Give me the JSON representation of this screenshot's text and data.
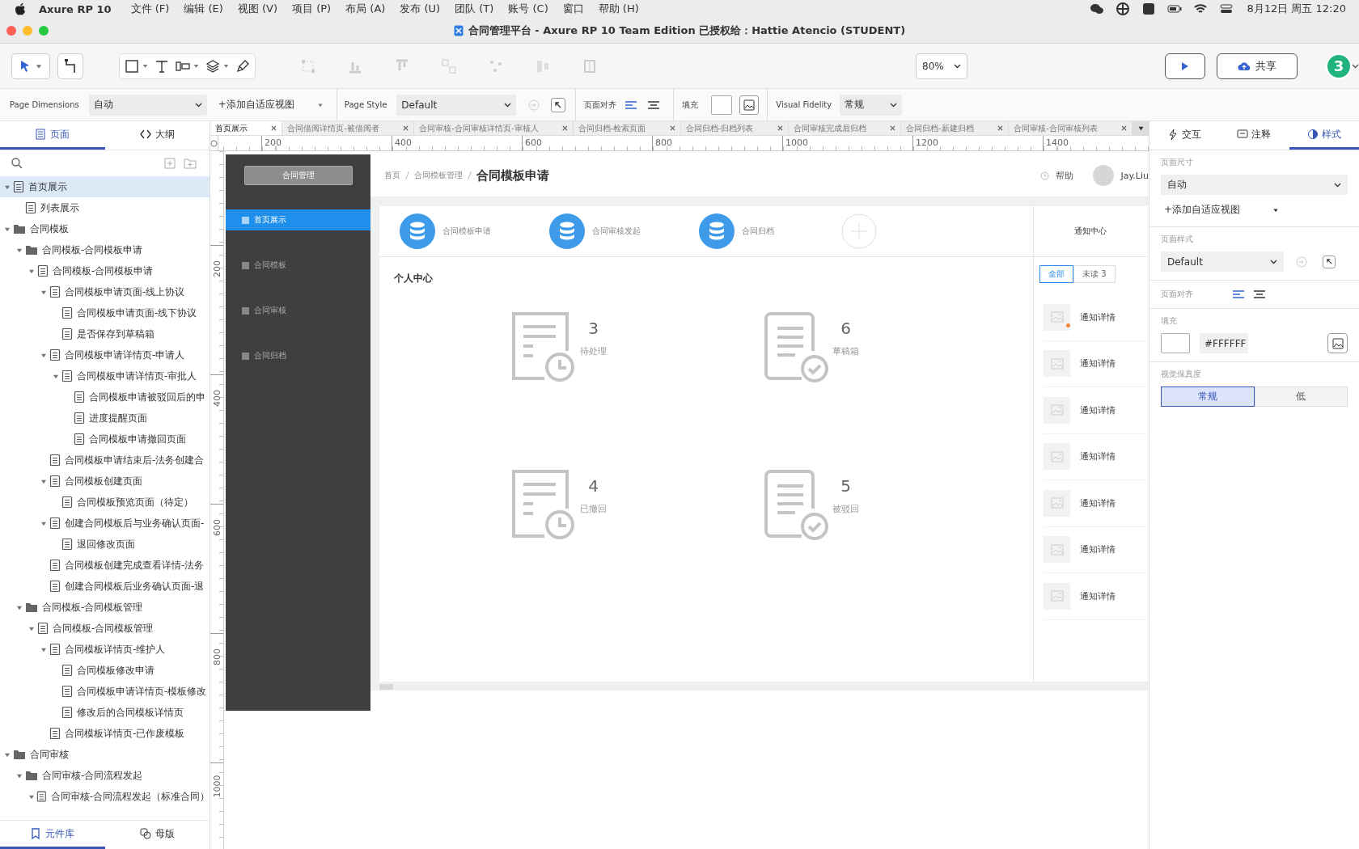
{
  "menu_bar": {
    "app": "Axure RP 10",
    "menus": [
      "文件 (F)",
      "编辑 (E)",
      "视图 (V)",
      "项目 (P)",
      "布局 (A)",
      "发布 (U)",
      "团队 (T)",
      "账号 (C)",
      "窗口",
      "帮助 (H)"
    ],
    "clock": "8月12日 周五  12:20"
  },
  "window": {
    "title": "合同管理平台 - Axure RP 10 Team Edition  已授权给：Hattie Atencio (STUDENT)"
  },
  "toolbar": {
    "zoom": "80%",
    "share": "共享",
    "user_badge": "3"
  },
  "style_bar": {
    "page_dimensions_label": "Page Dimensions",
    "page_dimensions": "自动",
    "add_view": "+添加自适应视图",
    "page_style_label": "Page Style",
    "page_style": "Default",
    "page_align_label": "页面对齐",
    "page_align": [
      {
        "kind": "left",
        "selected": true
      },
      {
        "kind": "center",
        "selected": false
      }
    ],
    "fill_label": "填充",
    "fidelity_label": "Visual Fidelity",
    "fidelity": "常规"
  },
  "left_panel": {
    "tabs": [
      {
        "label": "页面",
        "selected": true
      },
      {
        "label": "大纲",
        "selected": false
      }
    ],
    "pages": [
      {
        "label": "首页展示",
        "kind": "page",
        "selected": true,
        "expanded": true,
        "children": [
          {
            "label": "列表展示",
            "kind": "page",
            "selected": false
          }
        ]
      },
      {
        "label": "合同模板",
        "kind": "folder",
        "selected": false,
        "expanded": true,
        "children": [
          {
            "label": "合同模板-合同模板申请",
            "kind": "folder",
            "selected": false,
            "expanded": true,
            "children": [
              {
                "label": "合同模板-合同模板申请",
                "kind": "page",
                "selected": false,
                "expanded": true,
                "children": [
                  {
                    "label": "合同模板申请页面-线上协议",
                    "kind": "page",
                    "selected": false,
                    "expanded": true,
                    "children": [
                      {
                        "label": "合同模板申请页面-线下协议",
                        "kind": "page",
                        "selected": false
                      },
                      {
                        "label": "是否保存到草稿箱",
                        "kind": "page",
                        "selected": false
                      }
                    ]
                  },
                  {
                    "label": "合同模板申请详情页-申请人",
                    "kind": "page",
                    "selected": false,
                    "expanded": true,
                    "children": [
                      {
                        "label": "合同模板申请详情页-审批人",
                        "kind": "page",
                        "selected": false,
                        "expanded": true,
                        "children": [
                          {
                            "label": "合同模板申请被驳回后的申",
                            "kind": "page",
                            "selected": false
                          },
                          {
                            "label": "进度提醒页面",
                            "kind": "page",
                            "selected": false
                          },
                          {
                            "label": "合同模板申请撤回页面",
                            "kind": "page",
                            "selected": false
                          }
                        ]
                      }
                    ]
                  },
                  {
                    "label": "合同模板申请结束后-法务创建合",
                    "kind": "page",
                    "selected": false
                  },
                  {
                    "label": "合同模板创建页面",
                    "kind": "page",
                    "selected": false,
                    "expanded": true,
                    "children": [
                      {
                        "label": "合同模板预览页面（待定）",
                        "kind": "page",
                        "selected": false
                      }
                    ]
                  },
                  {
                    "label": "创建合同模板后与业务确认页面-",
                    "kind": "page",
                    "selected": false,
                    "expanded": true,
                    "children": [
                      {
                        "label": "退回修改页面",
                        "kind": "page",
                        "selected": false
                      }
                    ]
                  },
                  {
                    "label": "合同模板创建完成查看详情-法务",
                    "kind": "page",
                    "selected": false
                  },
                  {
                    "label": "创建合同模板后业务确认页面-退",
                    "kind": "page",
                    "selected": false
                  }
                ]
              }
            ]
          },
          {
            "label": "合同模板-合同模板管理",
            "kind": "folder",
            "selected": false,
            "expanded": true,
            "children": [
              {
                "label": "合同模板-合同模板管理",
                "kind": "page",
                "selected": false,
                "expanded": true,
                "children": [
                  {
                    "label": "合同模板详情页-维护人",
                    "kind": "page",
                    "selected": false,
                    "expanded": true,
                    "children": [
                      {
                        "label": "合同模板修改申请",
                        "kind": "page",
                        "selected": false
                      },
                      {
                        "label": "合同模板申请详情页-模板修改",
                        "kind": "page",
                        "selected": false
                      },
                      {
                        "label": "修改后的合同模板详情页",
                        "kind": "page",
                        "selected": false
                      }
                    ]
                  },
                  {
                    "label": "合同模板详情页-已作废模板",
                    "kind": "page",
                    "selected": false
                  }
                ]
              }
            ]
          }
        ]
      },
      {
        "label": "合同审核",
        "kind": "folder",
        "selected": false,
        "expanded": true,
        "children": [
          {
            "label": "合同审核-合同流程发起",
            "kind": "folder",
            "selected": false,
            "expanded": true,
            "children": [
              {
                "label": "合同审核-合同流程发起（标准合同）",
                "kind": "page",
                "selected": false,
                "expanded": true
              }
            ]
          }
        ]
      }
    ],
    "bottom_tabs": [
      {
        "label": "元件库",
        "selected": true
      },
      {
        "label": "母版",
        "selected": false
      }
    ]
  },
  "document_tabs": [
    {
      "label": "首页展示",
      "selected": true
    },
    {
      "label": "合同借阅详情页-被借阅者",
      "selected": false
    },
    {
      "label": "合同审核-合同审核详情页-审核人",
      "selected": false
    },
    {
      "label": "合同归档-检索页面",
      "selected": false
    },
    {
      "label": "合同归档-归档列表",
      "selected": false
    },
    {
      "label": "合同审核完成后归档",
      "selected": false
    },
    {
      "label": "合同归档-新建归档",
      "selected": false
    },
    {
      "label": "合同审核-合同审核列表",
      "selected": false
    }
  ],
  "ruler": {
    "x_labels": [
      "200",
      "400",
      "600",
      "800",
      "1000",
      "1200",
      "1400"
    ],
    "y_labels": [
      "200",
      "400",
      "600",
      "800",
      "1000"
    ]
  },
  "prototype": {
    "sidebar": {
      "button": "合同管理",
      "items": [
        {
          "label": "首页展示",
          "selected": true
        },
        {
          "label": "合同模板",
          "selected": false
        },
        {
          "label": "合同审核",
          "selected": false
        },
        {
          "label": "合同归档",
          "selected": false
        }
      ]
    },
    "breadcrumb": [
      "首页",
      "合同模板管理",
      "合同模板申请"
    ],
    "help": "帮助",
    "user": "Jay.Liu",
    "shortcuts": [
      {
        "label": "合同模板申请"
      },
      {
        "label": "合同审核发起"
      },
      {
        "label": "合同归档"
      }
    ],
    "section_title": "个人中心",
    "stats": [
      {
        "count": "3",
        "label": "待处理",
        "kind": "clock"
      },
      {
        "count": "6",
        "label": "草稿箱",
        "kind": "check"
      },
      {
        "count": "4",
        "label": "已撤回",
        "kind": "clock"
      },
      {
        "count": "5",
        "label": "被驳回",
        "kind": "check"
      }
    ],
    "notifications": {
      "title": "通知中心",
      "tabs": [
        {
          "label": "全部",
          "selected": true
        },
        {
          "label": "未读 3",
          "selected": false
        }
      ],
      "items": [
        {
          "text": "通知详情",
          "unread": true
        },
        {
          "text": "通知详情",
          "unread": false
        },
        {
          "text": "通知详情",
          "unread": false
        },
        {
          "text": "通知详情",
          "unread": false
        },
        {
          "text": "通知详情",
          "unread": false
        },
        {
          "text": "通知详情",
          "unread": false
        },
        {
          "text": "通知详情",
          "unread": false
        }
      ]
    }
  },
  "right_panel": {
    "tabs": [
      {
        "label": "交互",
        "selected": false
      },
      {
        "label": "注释",
        "selected": false
      },
      {
        "label": "样式",
        "selected": true
      }
    ],
    "page_size_label": "页面尺寸",
    "page_size": "自动",
    "add_view": "+添加自适应视图",
    "page_style_label": "页面样式",
    "page_style": "Default",
    "page_align_label": "页面对齐",
    "page_align": [
      {
        "kind": "left",
        "selected": true
      },
      {
        "kind": "center",
        "selected": false
      }
    ],
    "fill_label": "填充",
    "fill_value": "#FFFFFF",
    "fidelity_label": "视觉保真度",
    "fidelity_options": [
      {
        "label": "常规",
        "selected": true
      },
      {
        "label": "低",
        "selected": false
      }
    ]
  }
}
